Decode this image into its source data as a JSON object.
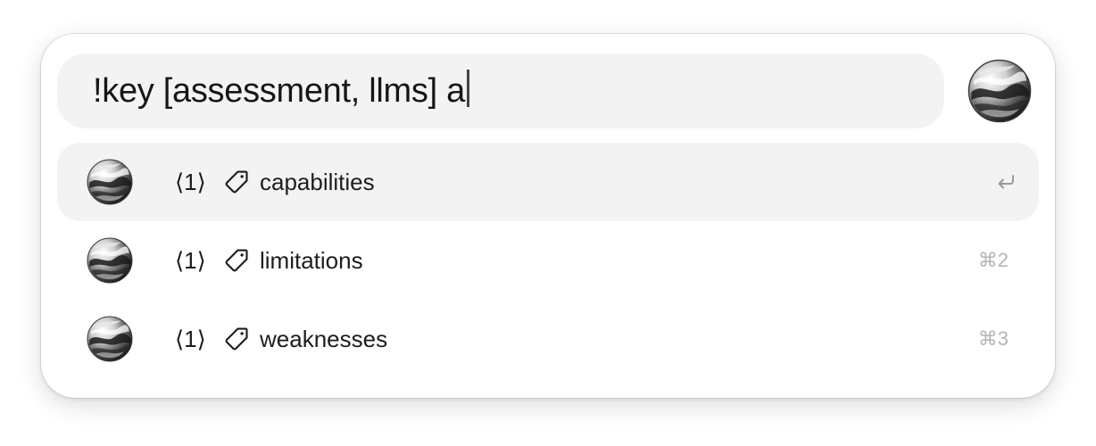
{
  "search": {
    "query": "!key [assessment, llms] a"
  },
  "results": [
    {
      "count": "⟨1⟩",
      "icon": "tag-icon",
      "label": "capabilities",
      "shortcut_icon": "return-icon",
      "selected": true
    },
    {
      "count": "⟨1⟩",
      "icon": "tag-icon",
      "label": "limitations",
      "shortcut": "⌘2",
      "selected": false
    },
    {
      "count": "⟨1⟩",
      "icon": "tag-icon",
      "label": "weaknesses",
      "shortcut": "⌘3",
      "selected": false
    }
  ],
  "colors": {
    "panel_background": "#ffffff",
    "search_background": "#f3f3f3",
    "selected_row_background": "#f3f3f3",
    "text": "#1d1d1d",
    "shortcut_text": "#b4b4b4"
  }
}
